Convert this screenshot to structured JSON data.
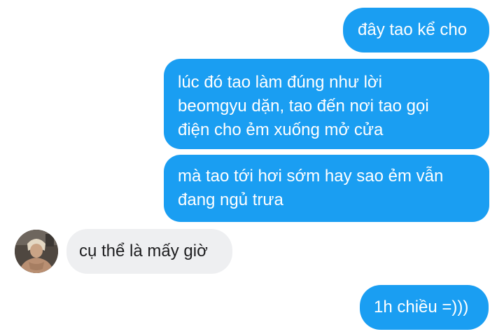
{
  "chat": {
    "messages": [
      {
        "side": "outgoing",
        "text": "đây tao kể cho"
      },
      {
        "side": "outgoing",
        "text": "lúc đó tao làm đúng như lời\nbeomgyu dặn, tao đến nơi tao gọi\nđiện cho ẻm xuống mở cửa"
      },
      {
        "side": "outgoing",
        "text": "mà tao tới hơi sớm hay sao ẻm vẫn\nđang ngủ trưa"
      },
      {
        "side": "incoming",
        "text": "cụ thể là mấy giờ"
      },
      {
        "side": "outgoing",
        "text": "1h chiều =)))"
      }
    ]
  },
  "colors": {
    "outgoing_bubble": "#1a9ef2",
    "incoming_bubble": "#eeeff1",
    "outgoing_text": "#ffffff",
    "incoming_text": "#1d1d1f"
  },
  "icons": {
    "sender_avatar": "avatar-photo"
  }
}
